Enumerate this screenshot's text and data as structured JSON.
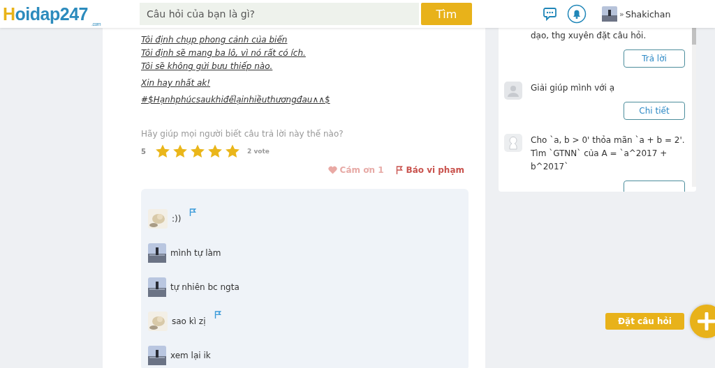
{
  "header": {
    "logo": {
      "first": "H",
      "rest": "oidap247",
      "sub": ".com"
    },
    "search": {
      "placeholder": "Câu hỏi của bạn là gì?"
    },
    "search_button": "Tìm",
    "user": {
      "caret": "»",
      "name": "Shakichan"
    }
  },
  "answer": {
    "paragraphs": [
      [
        "Tôi định chụp phong cảnh của biển",
        "Tôi định sẽ mang ba lô, vì nó rất có ích.",
        "Tôi sẽ không gửi bưu thiếp nào."
      ],
      [
        "Xin hay nhất ak!"
      ],
      [
        "#$Hạnhphúcsaukhiđểlạinhiềuthươngđau∧∧$"
      ]
    ],
    "rating_prompt": "Hãy giúp mọi người biết câu trả lời này thế nào?",
    "score": "5",
    "stars": 5,
    "votes": "2 vote",
    "thanks": "Cám ơn 1",
    "report": "Báo vi phạm"
  },
  "comments": [
    {
      "kind": "cat",
      "text": ":))",
      "flag": true
    },
    {
      "kind": "person",
      "text": "mình tự làm",
      "flag": false
    },
    {
      "kind": "person",
      "text": "tự nhiên bc ngta",
      "flag": false
    },
    {
      "kind": "cat",
      "text": "sao kì zị",
      "flag": true
    },
    {
      "kind": "person",
      "text": "xem lại ik",
      "flag": false
    }
  ],
  "sidebar": {
    "items": [
      {
        "kind": "noavatar",
        "text": "dạo, thg xuyên đặt câu hỏi.",
        "button": "Trả lời"
      },
      {
        "kind": "blank",
        "text": "Giải giúp mình với ạ",
        "button": "Chi tiết"
      },
      {
        "kind": "outline",
        "text": "Cho `a, b > 0' thỏa mãn `a + b = 2'. Tìm `GTNN` của A = `a^2017 + b^2017`"
      }
    ]
  },
  "fab": {
    "label": "Đặt câu hỏi"
  }
}
